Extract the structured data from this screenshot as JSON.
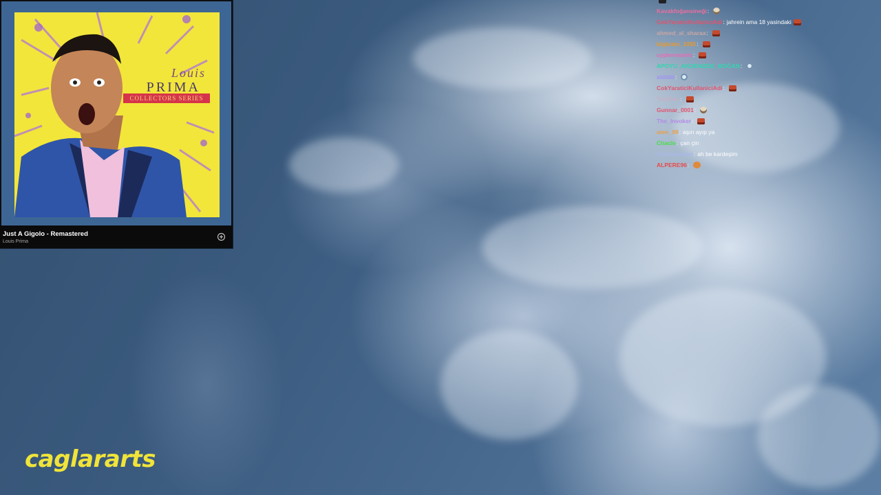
{
  "now_playing": {
    "title": "Just A Gigolo - Remastered",
    "artist": "Louis Prima",
    "album_art": {
      "line1": "Louis",
      "line2": "PRIMA",
      "ribbon": "COLLECTORS SERIES"
    },
    "add_icon": "plus-circle-icon"
  },
  "chat": {
    "messages": [
      {
        "user": "",
        "color": "#e05b7a",
        "text": "",
        "emote": "dark"
      },
      {
        "user": "Kavakfoğansineği",
        "color": "#ef6ea0",
        "text": "",
        "emote": "face"
      },
      {
        "user": "CokYaraticiKullaniciAdi",
        "color": "#e2546d",
        "text": "jahrein ama 18 yasindaki",
        "emote": "red"
      },
      {
        "user": "ahmed_al_sharaa",
        "color": "#c7a6a6",
        "text": "",
        "emote": "red"
      },
      {
        "user": "bigbrain_1055",
        "color": "#e89a2a",
        "text": "",
        "emote": "red"
      },
      {
        "user": "cyphermuhtr",
        "color": "#e86ab5",
        "text": "",
        "emote": "red"
      },
      {
        "user": "APOYU_AKDENIZDE_BOĞAN",
        "color": "#2fd6b0",
        "text": "",
        "emote": "round"
      },
      {
        "user": "xiiiiiiiii",
        "color": "#9f8ff5",
        "text": "",
        "emote": "round"
      },
      {
        "user": "CokYaraticiKullaniciAdi",
        "color": "#e2546d",
        "text": "",
        "emote": "red"
      },
      {
        "user": "TurkDev",
        "color": "#c7b0c4",
        "text": "",
        "emote": "red"
      },
      {
        "user": "Gunnar_0001",
        "color": "#e2546d",
        "text": "",
        "emote": "face"
      },
      {
        "user": "The_Invoker",
        "color": "#b28ae6",
        "text": "",
        "emote": "red"
      },
      {
        "user": "aten_99",
        "color": "#e8a04a",
        "text": "aşırı ayıp ya",
        "emote": ""
      },
      {
        "user": "Chacle",
        "color": "#48e048",
        "text": "çan çin",
        "emote": ""
      },
      {
        "user": "2homelander",
        "color": "#a8b8e8",
        "text": "ah be kardeşim",
        "emote": ""
      },
      {
        "user": "ALPERE96",
        "color": "#e84a4a",
        "text": "",
        "emote": "orange"
      }
    ]
  },
  "watermark": {
    "text": "caglararts",
    "color": "#f0e43a"
  }
}
